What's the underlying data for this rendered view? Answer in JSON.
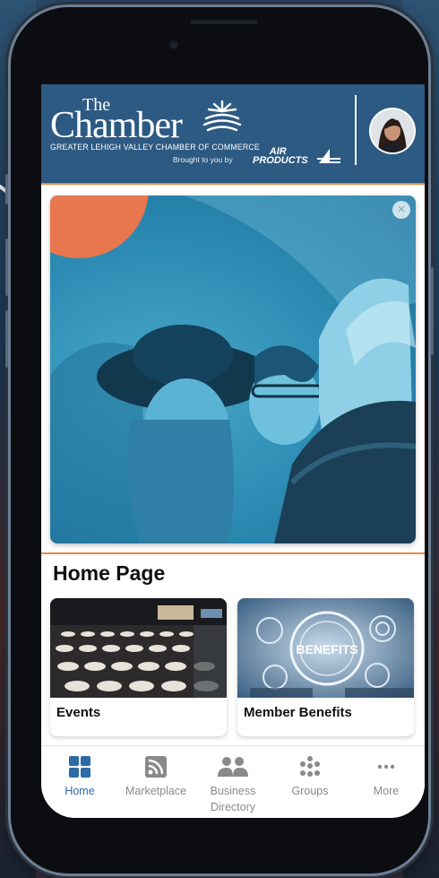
{
  "header": {
    "logo_the": "The",
    "logo_chamber": "Chamber",
    "logo_subtitle": "GREATER LEHIGH VALLEY CHAMBER OF COMMERCE",
    "brought_by": "Brought to you by",
    "sponsor_line1": "AIR",
    "sponsor_line2": "PRODUCTS"
  },
  "section": {
    "title": "Home Page"
  },
  "cards": [
    {
      "label": "Events",
      "image": "banquet-hall-photo"
    },
    {
      "label": "Member Benefits",
      "image": "benefits-graphic"
    }
  ],
  "tabs": [
    {
      "label": "Home",
      "icon": "home-grid-icon",
      "active": true
    },
    {
      "label": "Marketplace",
      "icon": "rss-feed-icon",
      "active": false
    },
    {
      "label": "Business Directory",
      "icon": "people-icon",
      "active": false
    },
    {
      "label": "Groups",
      "icon": "groups-dots-icon",
      "active": false
    },
    {
      "label": "More",
      "icon": "ellipsis-icon",
      "active": false
    }
  ],
  "colors": {
    "header_bg": "#2d5a82",
    "accent": "#e8893f",
    "active_tab": "#2d6aa6",
    "promo_tint": "#2f8fb6"
  }
}
